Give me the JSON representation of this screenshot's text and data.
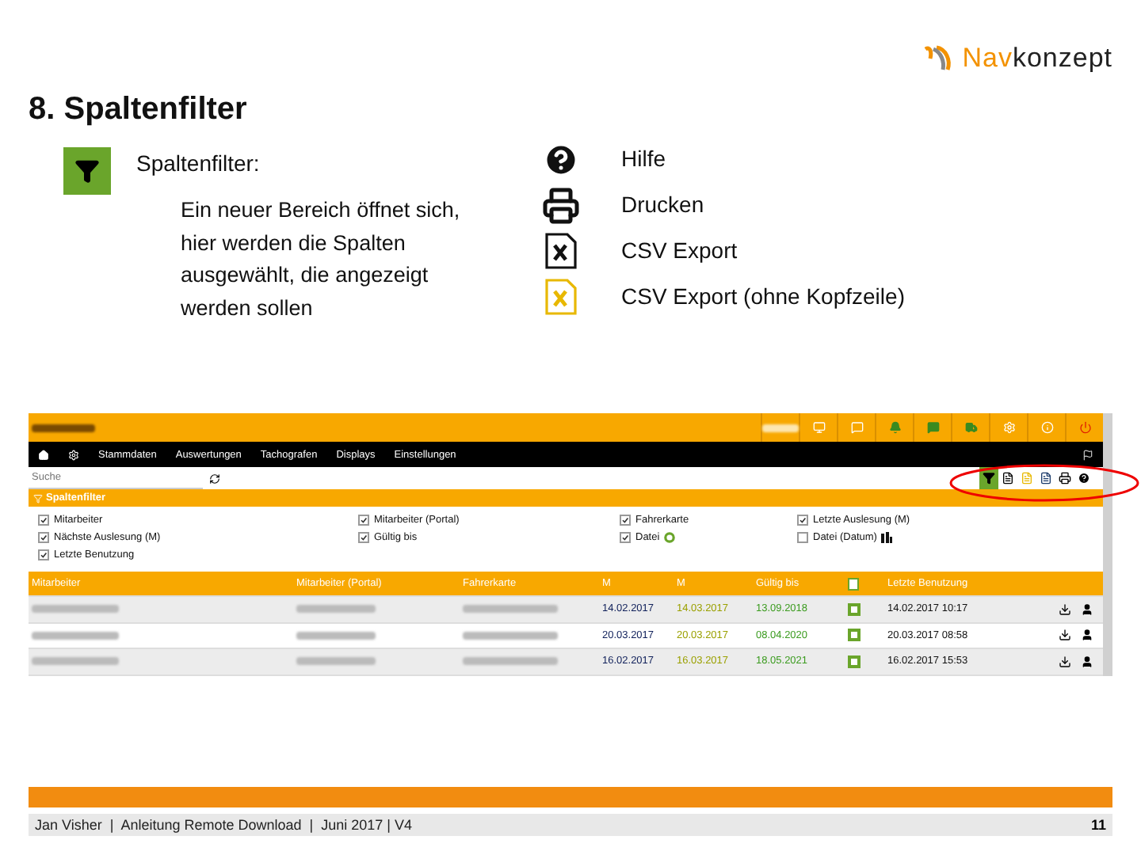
{
  "logo": {
    "part_a": "Nav",
    "part_b": "konzept"
  },
  "title": "8. Spaltenfilter",
  "legend_left": {
    "label": "Spaltenfilter:",
    "description": "Ein neuer Bereich öffnet sich, hier werden die Spalten ausgewählt, die angezeigt werden sollen"
  },
  "legend_right": [
    {
      "kind": "help",
      "label": "Hilfe"
    },
    {
      "kind": "print",
      "label": "Drucken"
    },
    {
      "kind": "csv",
      "label": "CSV Export"
    },
    {
      "kind": "csv_noheader",
      "label": "CSV Export (ohne Kopfzeile)"
    }
  ],
  "app": {
    "nav": [
      "Stammdaten",
      "Auswertungen",
      "Tachografen",
      "Displays",
      "Einstellungen"
    ],
    "search": {
      "placeholder": "Suche"
    },
    "toolbar": [
      {
        "kind": "filter",
        "active": true
      },
      {
        "kind": "print",
        "active": false
      },
      {
        "kind": "csv_noheader",
        "active": false
      },
      {
        "kind": "csv",
        "active": false
      },
      {
        "kind": "printer",
        "active": false
      },
      {
        "kind": "help",
        "active": false
      }
    ],
    "filter_panel": {
      "title": "Spaltenfilter",
      "options": [
        {
          "label": "Mitarbeiter",
          "checked": true
        },
        {
          "label": "Mitarbeiter (Portal)",
          "checked": true
        },
        {
          "label": "Fahrerkarte",
          "checked": true
        },
        {
          "label": "Letzte Auslesung (M)",
          "checked": true
        },
        {
          "label": "Nächste Auslesung (M)",
          "checked": true
        },
        {
          "label": "Gültig bis",
          "checked": true
        },
        {
          "label": "Datei",
          "checked": true,
          "kind": "file_ok"
        },
        {
          "label": "Datei (Datum)",
          "checked": false,
          "kind": "file_date"
        },
        {
          "label": "Letzte Benutzung",
          "checked": true
        }
      ]
    },
    "table": {
      "columns": [
        "Mitarbeiter",
        "Mitarbeiter (Portal)",
        "Fahrerkarte",
        "M",
        "M",
        "Gültig bis",
        "",
        "Letzte Benutzung"
      ],
      "rows": [
        {
          "cells": [
            "",
            "",
            "",
            "14.02.2017",
            "14.03.2017",
            "13.09.2018",
            "",
            "14.02.2017 10:17"
          ]
        },
        {
          "cells": [
            "",
            "",
            "",
            "20.03.2017",
            "20.03.2017",
            "08.04.2020",
            "",
            "20.03.2017 08:58"
          ]
        },
        {
          "cells": [
            "",
            "",
            "",
            "16.02.2017",
            "16.03.2017",
            "18.05.2021",
            "",
            "16.02.2017 15:53"
          ]
        }
      ]
    }
  },
  "footer": {
    "text": "Jan Visher  |  Anleitung Remote Download  |  Juni 2017 | V4",
    "page": "11"
  }
}
